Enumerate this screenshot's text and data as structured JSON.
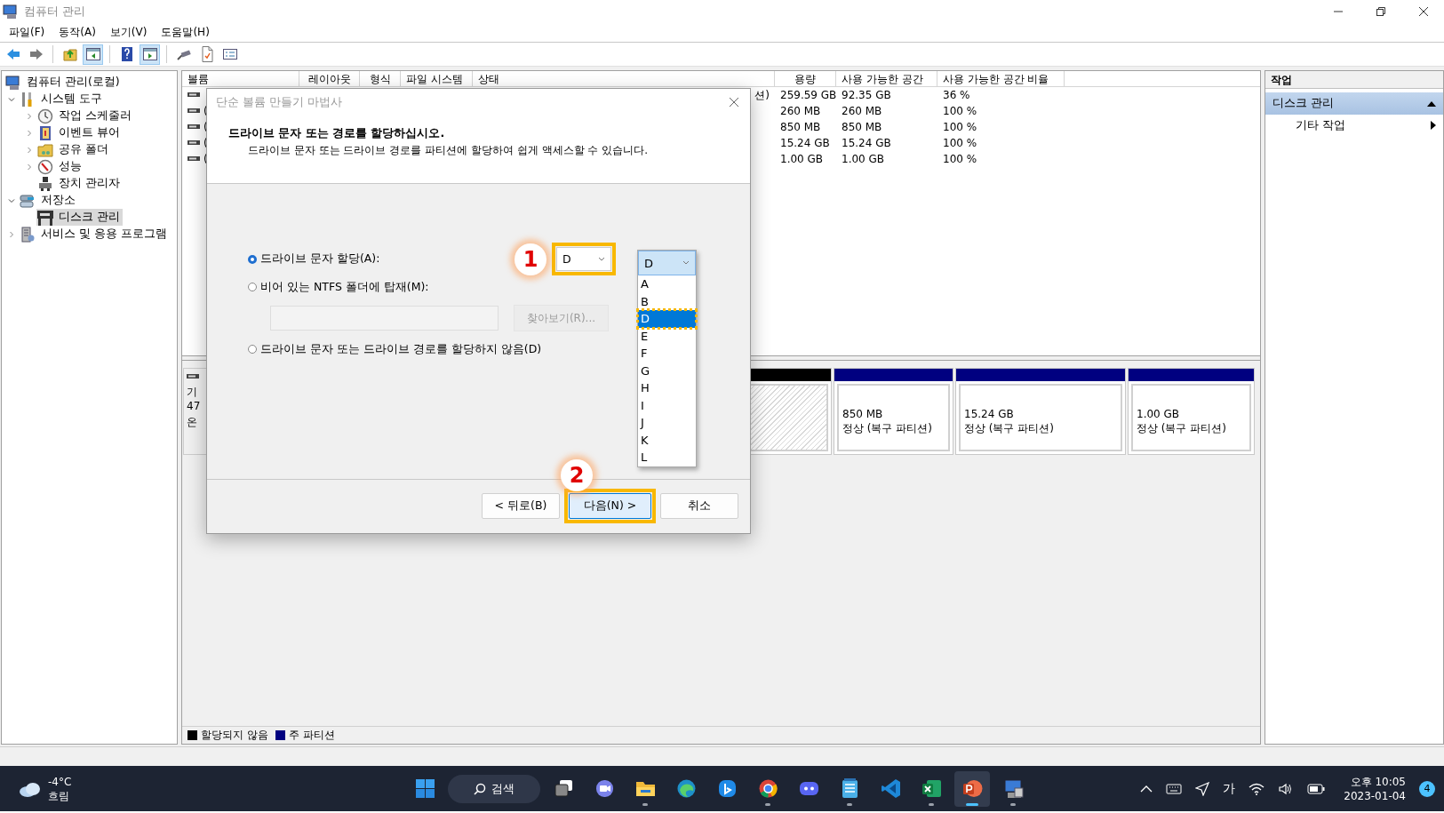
{
  "window": {
    "title": "컴퓨터 관리"
  },
  "menu": [
    "파일(F)",
    "동작(A)",
    "보기(V)",
    "도움말(H)"
  ],
  "toolbar": [
    {
      "kind": "back",
      "pressed": false
    },
    {
      "kind": "forward",
      "pressed": false
    },
    {
      "kind": "separator"
    },
    {
      "kind": "up",
      "pressed": false
    },
    {
      "kind": "console-tree",
      "pressed": true
    },
    {
      "kind": "separator"
    },
    {
      "kind": "help",
      "pressed": false
    },
    {
      "kind": "action-pane",
      "pressed": true
    },
    {
      "kind": "separator"
    },
    {
      "kind": "connect",
      "pressed": false
    },
    {
      "kind": "check",
      "pressed": false
    },
    {
      "kind": "list",
      "pressed": false
    }
  ],
  "tree": [
    {
      "label": "컴퓨터 관리(로컬)",
      "kind": "computer",
      "selected": false,
      "children": [
        {
          "label": "시스템 도구",
          "kind": "tools",
          "expanded": true,
          "selected": false,
          "children": [
            {
              "label": "작업 스케줄러",
              "kind": "clock",
              "expanded": false,
              "selected": false
            },
            {
              "label": "이벤트 뷰어",
              "kind": "event-log",
              "expanded": false,
              "selected": false
            },
            {
              "label": "공유 폴더",
              "kind": "shared-folder",
              "expanded": false,
              "selected": false
            },
            {
              "label": "성능",
              "kind": "performance",
              "expanded": false,
              "selected": false
            },
            {
              "label": "장치 관리자",
              "kind": "device-manager",
              "selected": false
            }
          ]
        },
        {
          "label": "저장소",
          "kind": "storage",
          "expanded": true,
          "selected": false,
          "children": [
            {
              "label": "디스크 관리",
              "kind": "disk",
              "selected": true
            }
          ]
        },
        {
          "label": "서비스 및 응용 프로그램",
          "kind": "services",
          "expanded": false,
          "selected": false
        }
      ]
    }
  ],
  "table": {
    "columns": [
      "볼륨",
      "레이아웃",
      "형식",
      "파일 시스템",
      "상태",
      "용량",
      "사용 가능한 공간",
      "사용 가능한 공간 비율"
    ],
    "rows": [
      {
        "status": "션)",
        "capacity": "259.59 GB",
        "free": "92.35 GB",
        "percent": "36 %"
      },
      {
        "volume": "(",
        "capacity": "260 MB",
        "free": "260 MB",
        "percent": "100 %"
      },
      {
        "volume": "(",
        "capacity": "850 MB",
        "free": "850 MB",
        "percent": "100 %"
      },
      {
        "volume": "(",
        "capacity": "15.24 GB",
        "free": "15.24 GB",
        "percent": "100 %"
      },
      {
        "volume": "(",
        "capacity": "1.00 GB",
        "free": "1.00 GB",
        "percent": "100 %"
      }
    ]
  },
  "disk_map": {
    "disk_label": [
      "기",
      "47",
      "온"
    ],
    "partitions": [
      {
        "kind": "unallocated",
        "color": "#000000"
      },
      {
        "kind": "primary",
        "color": "#000080",
        "size": "850 MB",
        "status": "정상 (복구 파티션)"
      },
      {
        "kind": "primary",
        "color": "#000080",
        "size": "15.24 GB",
        "status": "정상 (복구 파티션)"
      },
      {
        "kind": "primary",
        "color": "#000080",
        "size": "1.00 GB",
        "status": "정상 (복구 파티션)"
      }
    ]
  },
  "legend": [
    {
      "label": "할당되지 않음",
      "color": "#000000"
    },
    {
      "label": "주 파티션",
      "color": "#000080"
    }
  ],
  "actions": {
    "title": "작업",
    "sections": [
      {
        "label": "디스크 관리",
        "expanded": true,
        "items": [
          {
            "label": "기타 작업"
          }
        ]
      }
    ]
  },
  "dialog": {
    "title": "단순 볼륨 만들기 마법사",
    "heading": "드라이브 문자 또는 경로를 할당하십시오.",
    "description": "드라이브 문자 또는 드라이브 경로를 파티션에 할당하여 쉽게 액세스할 수 있습니다.",
    "options": [
      {
        "label": "드라이브 문자 할당(A):",
        "selected": true
      },
      {
        "label": "비어 있는 NTFS 폴더에 탑재(M):",
        "selected": false
      },
      {
        "label": "드라이브 문자 또는 드라이브 경로를 할당하지 않음(D)",
        "selected": false
      }
    ],
    "drive_letter": {
      "value": "D",
      "highlighted": true
    },
    "browse_button": {
      "label": "찾아보기(R)...",
      "disabled": true
    },
    "dropdown": {
      "value": "D",
      "items": [
        {
          "label": "A",
          "selected": false,
          "highlighted": false
        },
        {
          "label": "B",
          "selected": false,
          "highlighted": false
        },
        {
          "label": "D",
          "selected": true,
          "highlighted": true
        },
        {
          "label": "E",
          "selected": false,
          "highlighted": false
        },
        {
          "label": "F",
          "selected": false,
          "highlighted": false
        },
        {
          "label": "G",
          "selected": false,
          "highlighted": false
        },
        {
          "label": "H",
          "selected": false,
          "highlighted": false
        },
        {
          "label": "I",
          "selected": false,
          "highlighted": false
        },
        {
          "label": "J",
          "selected": false,
          "highlighted": false
        },
        {
          "label": "K",
          "selected": false,
          "highlighted": false
        },
        {
          "label": "L",
          "selected": false,
          "highlighted": false
        }
      ]
    },
    "buttons": [
      {
        "label": "< 뒤로(B)",
        "default": false,
        "highlighted": false
      },
      {
        "label": "다음(N) >",
        "default": true,
        "highlighted": true
      },
      {
        "label": "취소",
        "default": false,
        "highlighted": false
      }
    ],
    "callouts": [
      {
        "number": "1"
      },
      {
        "number": "2"
      }
    ]
  },
  "taskbar": {
    "weather": {
      "temperature": "-4°C",
      "condition": "흐림"
    },
    "search": {
      "label": "검색"
    },
    "apps": [
      {
        "kind": "start",
        "running": false,
        "active": false
      },
      {
        "kind": "taskview",
        "running": false,
        "active": false
      },
      {
        "kind": "meet",
        "running": false,
        "active": false
      },
      {
        "kind": "explorer",
        "running": true,
        "active": false
      },
      {
        "kind": "edge",
        "running": false,
        "active": false
      },
      {
        "kind": "bing",
        "running": false,
        "active": false
      },
      {
        "kind": "chrome",
        "running": true,
        "active": false
      },
      {
        "kind": "discord",
        "running": false,
        "active": false
      },
      {
        "kind": "notepad",
        "running": true,
        "active": false
      },
      {
        "kind": "vscode",
        "running": false,
        "active": false
      },
      {
        "kind": "excel",
        "running": true,
        "active": false
      },
      {
        "kind": "powerpoint",
        "running": true,
        "active": true
      },
      {
        "kind": "computer-management",
        "running": true,
        "active": false
      }
    ],
    "tray": {
      "ime": "가",
      "time": "오후 10:05",
      "date": "2023-01-04",
      "notifications": "4"
    }
  }
}
